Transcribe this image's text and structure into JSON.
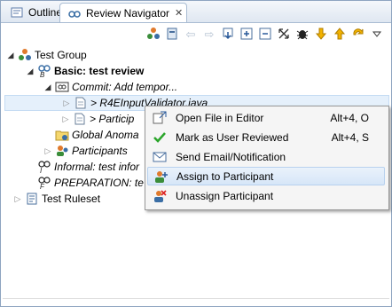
{
  "tabs": [
    {
      "label": "Outline"
    },
    {
      "label": "Review Navigator",
      "close": "✕"
    }
  ],
  "toolbar": {
    "icons": [
      "participants-icon",
      "review-icon",
      "nav-back-icon",
      "nav-forward-icon",
      "import-icon",
      "expand-all-icon",
      "collapse-all-icon",
      "resize-icon",
      "bug-icon",
      "down-arrow-icon",
      "up-arrow-icon",
      "refresh-icon",
      "view-menu-icon"
    ]
  },
  "tree": {
    "test_group": "Test Group",
    "basic_review": "Basic: test review",
    "commit": "Commit: Add tempor...",
    "file1": "> R4EInputValidator.java",
    "file2": "> Particip",
    "global_anomalies": "Global Anoma",
    "participants": "Participants",
    "informal": "Informal: test infor",
    "preparation": "PREPARATION: te",
    "test_ruleset": "Test Ruleset"
  },
  "menu": {
    "items": [
      {
        "label": "Open File in Editor",
        "shortcut": "Alt+4, O"
      },
      {
        "label": "Mark as User Reviewed",
        "shortcut": "Alt+4, S"
      },
      {
        "label": "Send Email/Notification",
        "shortcut": ""
      },
      {
        "label": "Assign to Participant",
        "shortcut": ""
      },
      {
        "label": "Unassign Participant",
        "shortcut": ""
      }
    ]
  }
}
